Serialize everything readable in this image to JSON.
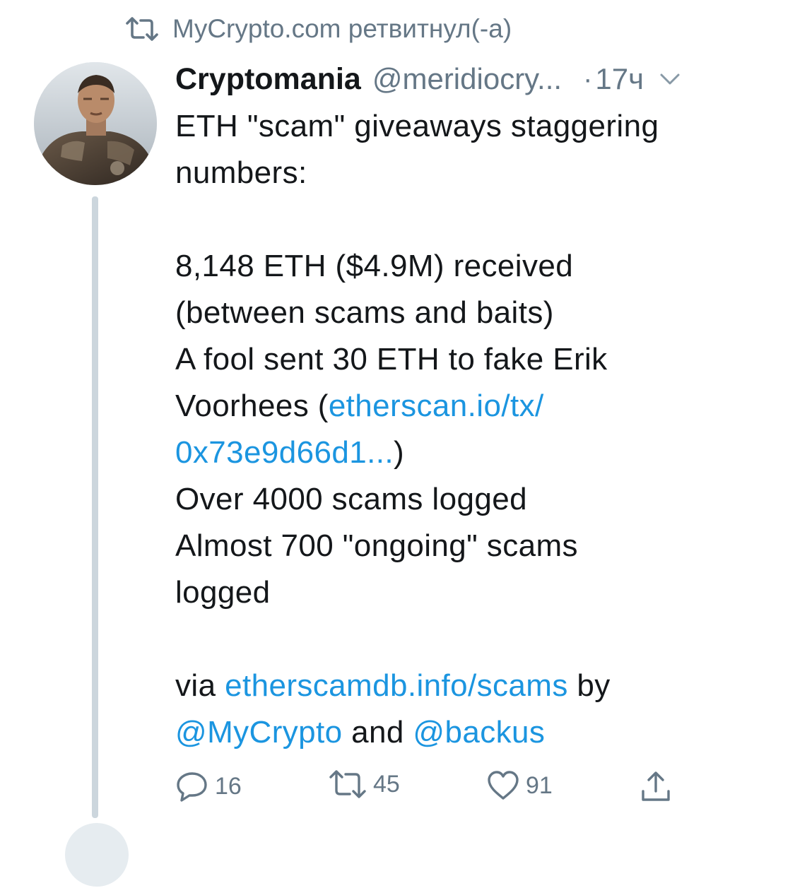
{
  "retweet": {
    "icon": "retweet-icon",
    "text": "MyCrypto.com ретвитнул(-а)"
  },
  "tweet": {
    "author_name": "Cryptomania",
    "author_handle": "@meridiocry...",
    "separator": "·",
    "timestamp": "17ч",
    "more_icon": "chevron-down-icon",
    "lines": {
      "l1": "ETH \"scam\" giveaways staggering",
      "l2": "numbers:",
      "l3": "8,148 ETH ($4.9M) received",
      "l4": "(between scams and baits)",
      "l5": "A fool sent 30 ETH to fake Erik",
      "l6_text": "Voorhees  (",
      "l6_link": "etherscan.io/tx/",
      "l7_link": "0x73e9d66d1...",
      "l7_text": ")",
      "l8": "Over 4000 scams logged",
      "l9": "Almost 700 \"ongoing\" scams",
      "l10": "logged",
      "l11_text": "via ",
      "l11_link": "etherscamdb.info/scams",
      "l11_suffix": " by",
      "l12_mention1": "@MyCrypto",
      "l12_mid": " and ",
      "l12_mention2": "@backus"
    }
  },
  "actions": {
    "reply": {
      "icon": "reply-icon",
      "count": "16"
    },
    "retweet": {
      "icon": "retweet-icon",
      "count": "45"
    },
    "like": {
      "icon": "heart-icon",
      "count": "91"
    },
    "share": {
      "icon": "share-icon"
    }
  },
  "colors": {
    "link": "#1b95e0",
    "secondary": "#657786",
    "text": "#14171a",
    "thread_line": "#ccd6dd"
  }
}
